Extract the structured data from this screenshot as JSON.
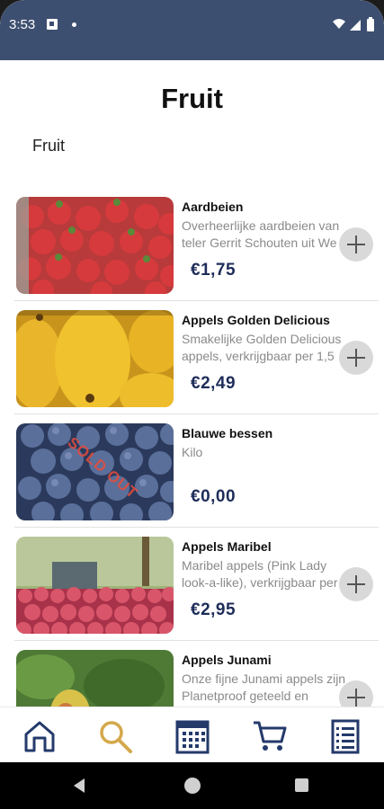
{
  "status_bar": {
    "time": "3:53"
  },
  "page": {
    "title": "Fruit",
    "category": "Fruit"
  },
  "products": [
    {
      "name": "Aardbeien",
      "description": "Overheerlijke aardbeien van teler Gerrit Schouten uit We",
      "price": "€1,75",
      "sold_out": false,
      "image": "strawberries"
    },
    {
      "name": "Appels Golden Delicious",
      "description": "Smakelijke Golden Delicious appels, verkrijgbaar per 1,5",
      "price": "€2,49",
      "sold_out": false,
      "image": "golden-apples"
    },
    {
      "name": "Blauwe bessen",
      "description": "Kilo",
      "price": "€0,00",
      "sold_out": true,
      "sold_out_label": "SOLD OUT",
      "image": "blueberries"
    },
    {
      "name": "Appels Maribel",
      "description": "Maribel appels (Pink Lady look-a-like), verkrijgbaar per",
      "price": "€2,95",
      "sold_out": false,
      "image": "red-apples"
    },
    {
      "name": "Appels Junami",
      "description": "Onze fijne Junami appels zijn Planetproof geteeld en",
      "price": "",
      "sold_out": false,
      "image": "apple-tree"
    }
  ],
  "bottom_nav": [
    {
      "icon": "home-icon",
      "active": false
    },
    {
      "icon": "search-icon",
      "active": true
    },
    {
      "icon": "calendar-icon",
      "active": false
    },
    {
      "icon": "cart-icon",
      "active": false
    },
    {
      "icon": "list-icon",
      "active": false
    }
  ],
  "colors": {
    "status_bar": "#3d4f70",
    "price": "#1e2d59",
    "nav_icon": "#243a6b",
    "nav_active": "#d4a84b",
    "sold_out": "#e74c3c"
  }
}
